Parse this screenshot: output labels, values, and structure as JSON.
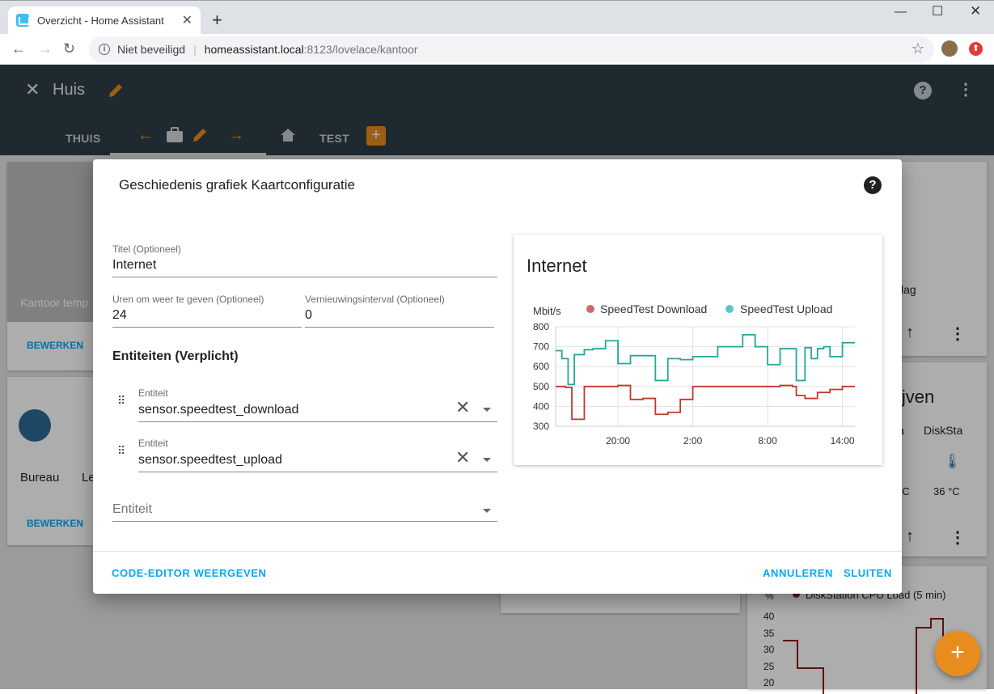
{
  "browser": {
    "tab_title": "Overzicht - Home Assistant",
    "security": "Niet beveiligd",
    "url_host": "homeassistant.local",
    "url_path": ":8123/lovelace/kantoor"
  },
  "header": {
    "title": "Huis",
    "tabs": [
      "THUIS",
      "TEST"
    ]
  },
  "background": {
    "card1_title": "Kantoor temp",
    "edit_label": "BEWERKEN",
    "light1": "Bureau",
    "light2": "Le",
    "right_text1": "lag",
    "right_heading": "ijven",
    "right_label_a": "a",
    "right_label_b": "DiskSta",
    "right_temp_a": "°C",
    "right_temp_b": "36 °C",
    "disk_legend": "DiskStation CPU Load (5 min)",
    "disk_unit": "%",
    "disk_ticks": [
      "40",
      "35",
      "30",
      "25",
      "20"
    ]
  },
  "dialog": {
    "title": "Geschiedenis grafiek Kaartconfiguratie",
    "title_field": {
      "label": "Titel (Optioneel)",
      "value": "Internet"
    },
    "hours_field": {
      "label": "Uren om weer te geven (Optioneel)",
      "value": "24"
    },
    "refresh_field": {
      "label": "Vernieuwingsinterval (Optioneel)",
      "value": "0"
    },
    "entities_heading": "Entiteiten (Verplicht)",
    "entities": [
      {
        "label": "Entiteit",
        "value": "sensor.speedtest_download"
      },
      {
        "label": "Entiteit",
        "value": "sensor.speedtest_upload"
      }
    ],
    "empty_entity_placeholder": "Entiteit",
    "code_editor_button": "CODE-EDITOR WEERGEVEN",
    "cancel_button": "ANNULEREN",
    "close_button": "SLUITEN"
  },
  "chart_data": {
    "type": "line",
    "title": "Internet",
    "ylabel": "Mbit/s",
    "ylim": [
      300,
      800
    ],
    "yticks": [
      800,
      700,
      600,
      500,
      400,
      300
    ],
    "x_ticks": [
      "20:00",
      "2:00",
      "8:00",
      "14:00"
    ],
    "xlim": [
      15,
      39
    ],
    "grid": true,
    "legend_position": "top",
    "series": [
      {
        "name": "SpeedTest Download",
        "color": "#c0392b",
        "step": true,
        "x": [
          15,
          15.8,
          16.3,
          17.3,
          20,
          21,
          22,
          23,
          24,
          25,
          26,
          33,
          34,
          34.3,
          35,
          36,
          37,
          38,
          39
        ],
        "values": [
          500,
          495,
          335,
          500,
          505,
          435,
          440,
          360,
          370,
          435,
          500,
          505,
          500,
          455,
          440,
          470,
          485,
          500,
          500
        ]
      },
      {
        "name": "SpeedTest Upload",
        "color": "#26a69a",
        "step": true,
        "x": [
          15,
          15.5,
          16,
          16.5,
          17.3,
          18,
          19,
          20,
          21,
          23,
          24,
          25,
          26,
          27,
          28,
          29,
          30,
          31,
          32,
          33,
          34,
          34.3,
          35,
          35.5,
          36,
          36.5,
          37,
          38,
          39
        ],
        "values": [
          680,
          640,
          510,
          660,
          685,
          690,
          730,
          615,
          655,
          530,
          640,
          635,
          650,
          650,
          700,
          700,
          760,
          700,
          610,
          690,
          690,
          530,
          695,
          640,
          690,
          700,
          650,
          720,
          720
        ]
      }
    ]
  }
}
